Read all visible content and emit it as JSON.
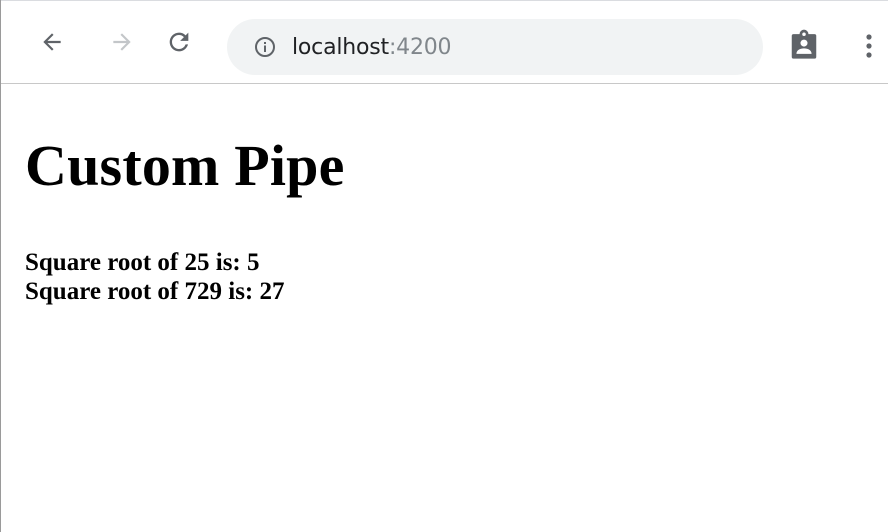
{
  "browser": {
    "url_host": "localhost",
    "url_port": ":4200",
    "icons": {
      "back": "arrow-left-icon",
      "forward": "arrow-right-icon",
      "reload": "reload-icon",
      "site_info": "info-icon",
      "extension": "clipboard-icon",
      "menu": "kebab-menu-icon"
    },
    "colors": {
      "icon_active": "#5f6368",
      "icon_disabled": "#c3c6c9",
      "omnibox_bg": "#f1f3f4"
    }
  },
  "page": {
    "heading": "Custom Pipe",
    "results": [
      "Square root of 25 is: 5",
      "Square root of 729 is: 27"
    ]
  }
}
